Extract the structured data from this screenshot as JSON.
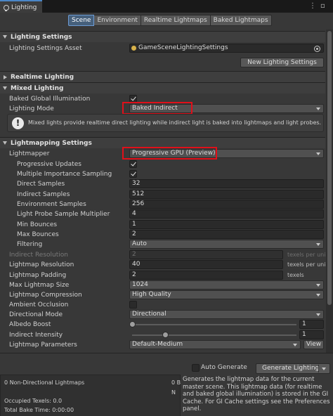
{
  "window": {
    "tab_title": "Lighting",
    "menu_glyph": "⋮",
    "close_glyph": "▫"
  },
  "toolbar": {
    "tabs": [
      "Scene",
      "Environment",
      "Realtime Lightmaps",
      "Baked Lightmaps"
    ],
    "active_tab": "Scene"
  },
  "lighting_settings": {
    "header": "Lighting Settings",
    "asset_label": "Lighting Settings Asset",
    "asset_value": "GameSceneLightingSettings",
    "new_button": "New Lighting Settings"
  },
  "realtime_lighting": {
    "header": "Realtime Lighting"
  },
  "mixed_lighting": {
    "header": "Mixed Lighting",
    "baked_gi_label": "Baked Global Illumination",
    "baked_gi_checked": true,
    "lighting_mode_label": "Lighting Mode",
    "lighting_mode_value": "Baked Indirect",
    "help_text": "Mixed lights provide realtime direct lighting while indirect light is baked into lightmaps and light probes."
  },
  "lightmapping": {
    "header": "Lightmapping Settings",
    "lightmapper_label": "Lightmapper",
    "lightmapper_value": "Progressive GPU (Preview)",
    "progressive_updates_label": "Progressive Updates",
    "progressive_updates_checked": true,
    "mis_label": "Multiple Importance Sampling",
    "mis_checked": true,
    "direct_samples_label": "Direct Samples",
    "direct_samples": "32",
    "indirect_samples_label": "Indirect Samples",
    "indirect_samples": "512",
    "environment_samples_label": "Environment Samples",
    "environment_samples": "256",
    "probe_mult_label": "Light Probe Sample Multiplier",
    "probe_mult": "4",
    "min_bounces_label": "Min Bounces",
    "min_bounces": "1",
    "max_bounces_label": "Max Bounces",
    "max_bounces": "2",
    "filtering_label": "Filtering",
    "filtering": "Auto",
    "indirect_resolution_label": "Indirect Resolution",
    "indirect_resolution": "2",
    "indirect_resolution_unit": "texels per unit",
    "lightmap_resolution_label": "Lightmap Resolution",
    "lightmap_resolution": "40",
    "lightmap_resolution_unit": "texels per unit",
    "lightmap_padding_label": "Lightmap Padding",
    "lightmap_padding": "2",
    "lightmap_padding_unit": "texels",
    "max_size_label": "Max Lightmap Size",
    "max_size": "1024",
    "compression_label": "Lightmap Compression",
    "compression": "High Quality",
    "ao_label": "Ambient Occlusion",
    "ao_checked": false,
    "directional_mode_label": "Directional Mode",
    "directional_mode": "Directional",
    "albedo_boost_label": "Albedo Boost",
    "albedo_boost": "1",
    "albedo_boost_fraction": 0.0,
    "indirect_intensity_label": "Indirect Intensity",
    "indirect_intensity": "1",
    "indirect_intensity_fraction": 0.2,
    "lightmap_params_label": "Lightmap Parameters",
    "lightmap_params": "Default-Medium",
    "view_button": "View"
  },
  "bottom": {
    "auto_generate_label": "Auto Generate",
    "auto_generate_checked": false,
    "generate_button": "Generate Lighting",
    "stats": {
      "lightmaps": "0 Non-Directional Lightmaps",
      "lightmaps_size": "0 B",
      "occupied_texels": "Occupied Texels: 0.0",
      "total_bake_time": "Total Bake Time: 0:00:00",
      "right_trunc": "N"
    },
    "description": "Generates the lightmap data for the current master scene.  This lightmap data (for realtime and baked global illumination) is stored in the GI Cache. For GI Cache settings see the Preferences panel."
  },
  "colors": {
    "highlight_box": "#e0101a",
    "active_tab": "#46607c"
  }
}
